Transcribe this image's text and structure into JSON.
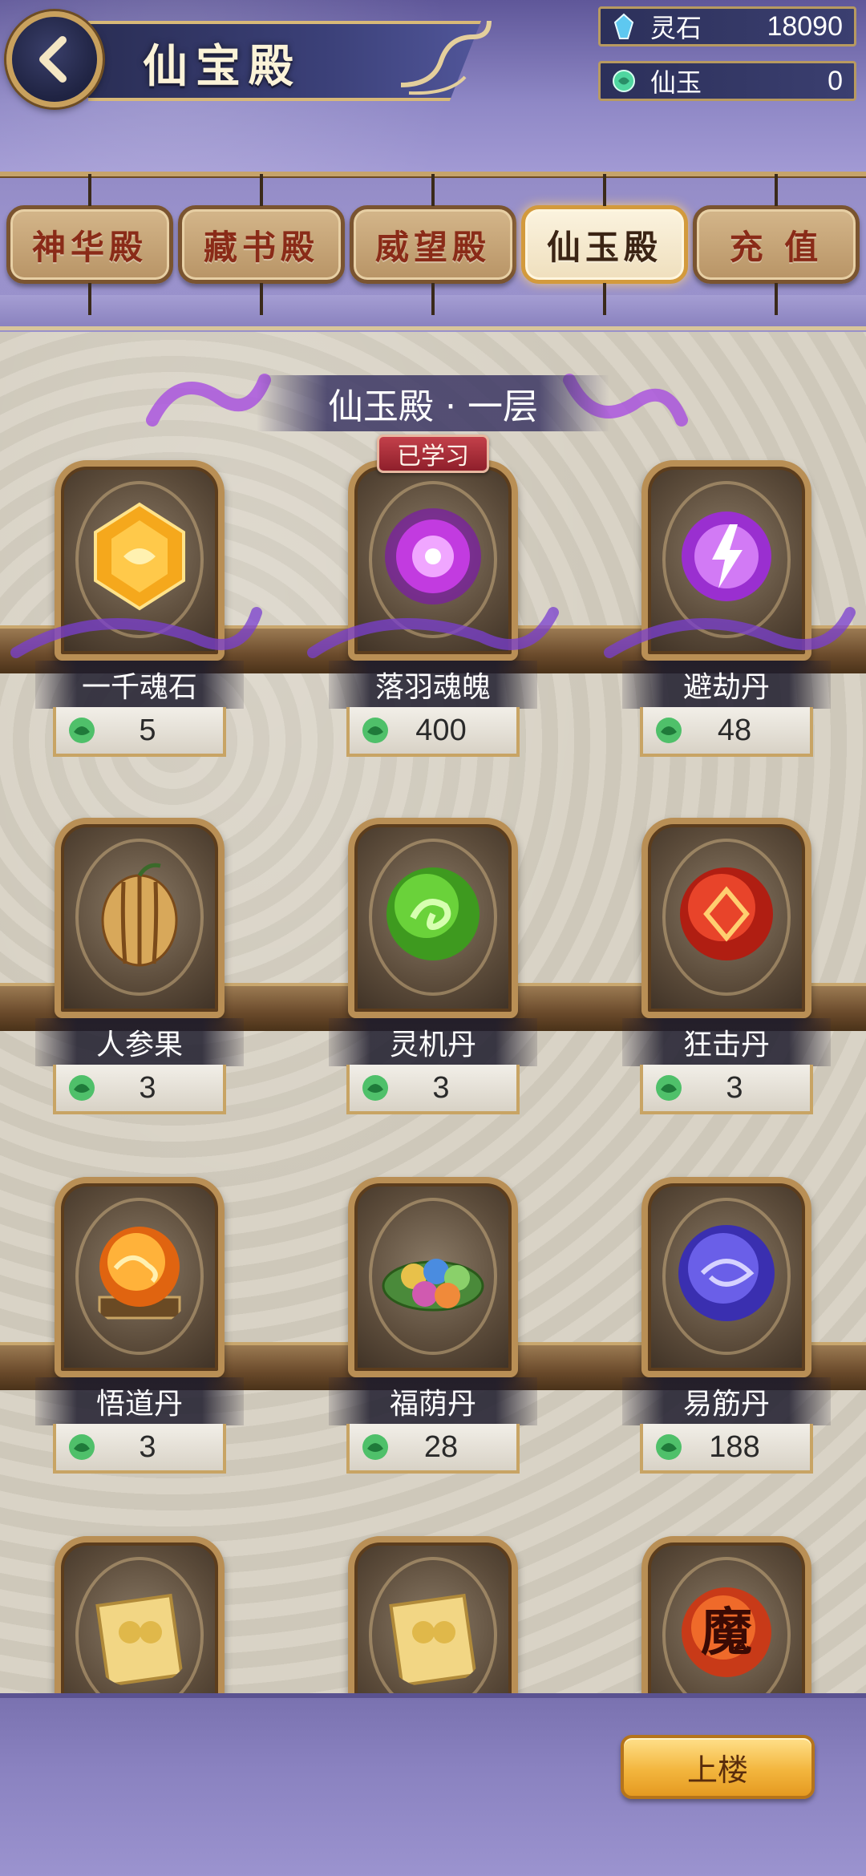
{
  "header": {
    "title": "仙宝殿",
    "currencies": [
      {
        "label": "灵石",
        "value": "18090",
        "icon": "blue-crystal-icon"
      },
      {
        "label": "仙玉",
        "value": "0",
        "icon": "jade-icon"
      }
    ]
  },
  "tabs": [
    {
      "label": "神华殿",
      "active": false
    },
    {
      "label": "藏书殿",
      "active": false
    },
    {
      "label": "威望殿",
      "active": false
    },
    {
      "label": "仙玉殿",
      "active": true
    },
    {
      "label": "充 值",
      "active": false
    }
  ],
  "floor": {
    "title": "仙玉殿 · 一层"
  },
  "items": [
    {
      "name": "一千魂石",
      "price": "5",
      "icon": "amber-gem-icon",
      "color": "#f2a21c"
    },
    {
      "name": "落羽魂魄",
      "price": "400",
      "icon": "purple-soul-orb-icon",
      "color": "#c23be0",
      "badge": "已学习"
    },
    {
      "name": "避劫丹",
      "price": "48",
      "icon": "lightning-orb-icon",
      "color": "#b552e0"
    },
    {
      "name": "人参果",
      "price": "3",
      "icon": "ginseng-fruit-icon",
      "color": "#d8a85a"
    },
    {
      "name": "灵机丹",
      "price": "3",
      "icon": "green-orb-icon",
      "color": "#5bbf2a"
    },
    {
      "name": "狂击丹",
      "price": "3",
      "icon": "red-orb-icon",
      "color": "#e23a1e"
    },
    {
      "name": "悟道丹",
      "price": "3",
      "icon": "fire-orb-icon",
      "color": "#f08a1a"
    },
    {
      "name": "福荫丹",
      "price": "28",
      "icon": "pill-leaf-icon",
      "color": "#6aa84f"
    },
    {
      "name": "易筋丹",
      "price": "188",
      "icon": "blue-orb-icon",
      "color": "#6a5fe8"
    },
    {
      "name": "",
      "price": "",
      "icon": "scroll-icon",
      "color": "#e8c46a"
    },
    {
      "name": "",
      "price": "",
      "icon": "scroll-icon",
      "color": "#e8c46a"
    },
    {
      "name": "",
      "price": "",
      "icon": "demon-orb-icon",
      "color": "#c83a18",
      "glyph_text": "魔"
    }
  ],
  "bottom": {
    "upstairs_label": "上楼"
  }
}
